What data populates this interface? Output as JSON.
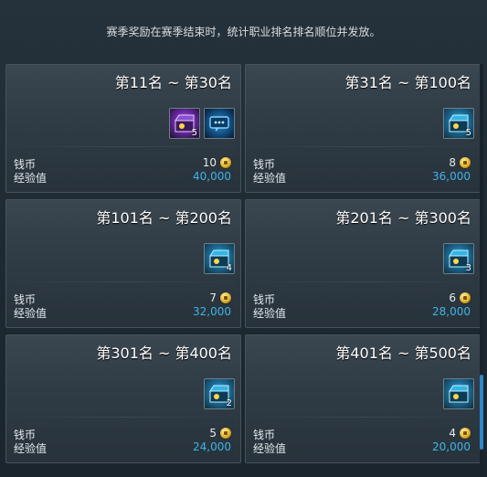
{
  "notice": "赛季奖励在赛季结束时，统计职业排名排名顺位并发放。",
  "labels": {
    "coin": "钱币",
    "exp": "经验值"
  },
  "icons": {
    "coin": "gold-coin-icon"
  },
  "cards": [
    {
      "range": "第11名 ~ 第30名",
      "items": [
        {
          "icon": "purple-treasure-chest-icon",
          "qty": "5"
        },
        {
          "icon": "blue-message-box-icon",
          "qty": ""
        }
      ],
      "coin": "10",
      "exp": "40,000"
    },
    {
      "range": "第31名 ~ 第100名",
      "items": [
        {
          "icon": "blue-treasure-chest-icon",
          "qty": "5"
        }
      ],
      "coin": "8",
      "exp": "36,000"
    },
    {
      "range": "第101名 ~ 第200名",
      "items": [
        {
          "icon": "blue-treasure-chest-icon",
          "qty": "4"
        }
      ],
      "coin": "7",
      "exp": "32,000"
    },
    {
      "range": "第201名 ~ 第300名",
      "items": [
        {
          "icon": "blue-treasure-chest-icon",
          "qty": "3"
        }
      ],
      "coin": "6",
      "exp": "28,000"
    },
    {
      "range": "第301名 ~ 第400名",
      "items": [
        {
          "icon": "blue-treasure-chest-icon",
          "qty": "2"
        }
      ],
      "coin": "5",
      "exp": "24,000"
    },
    {
      "range": "第401名 ~ 第500名",
      "items": [
        {
          "icon": "blue-treasure-chest-icon",
          "qty": ""
        }
      ],
      "coin": "4",
      "exp": "20,000"
    }
  ],
  "colors": {
    "exp_value": "#3fb3e6",
    "scroll_thumb": "#2f86c8"
  }
}
